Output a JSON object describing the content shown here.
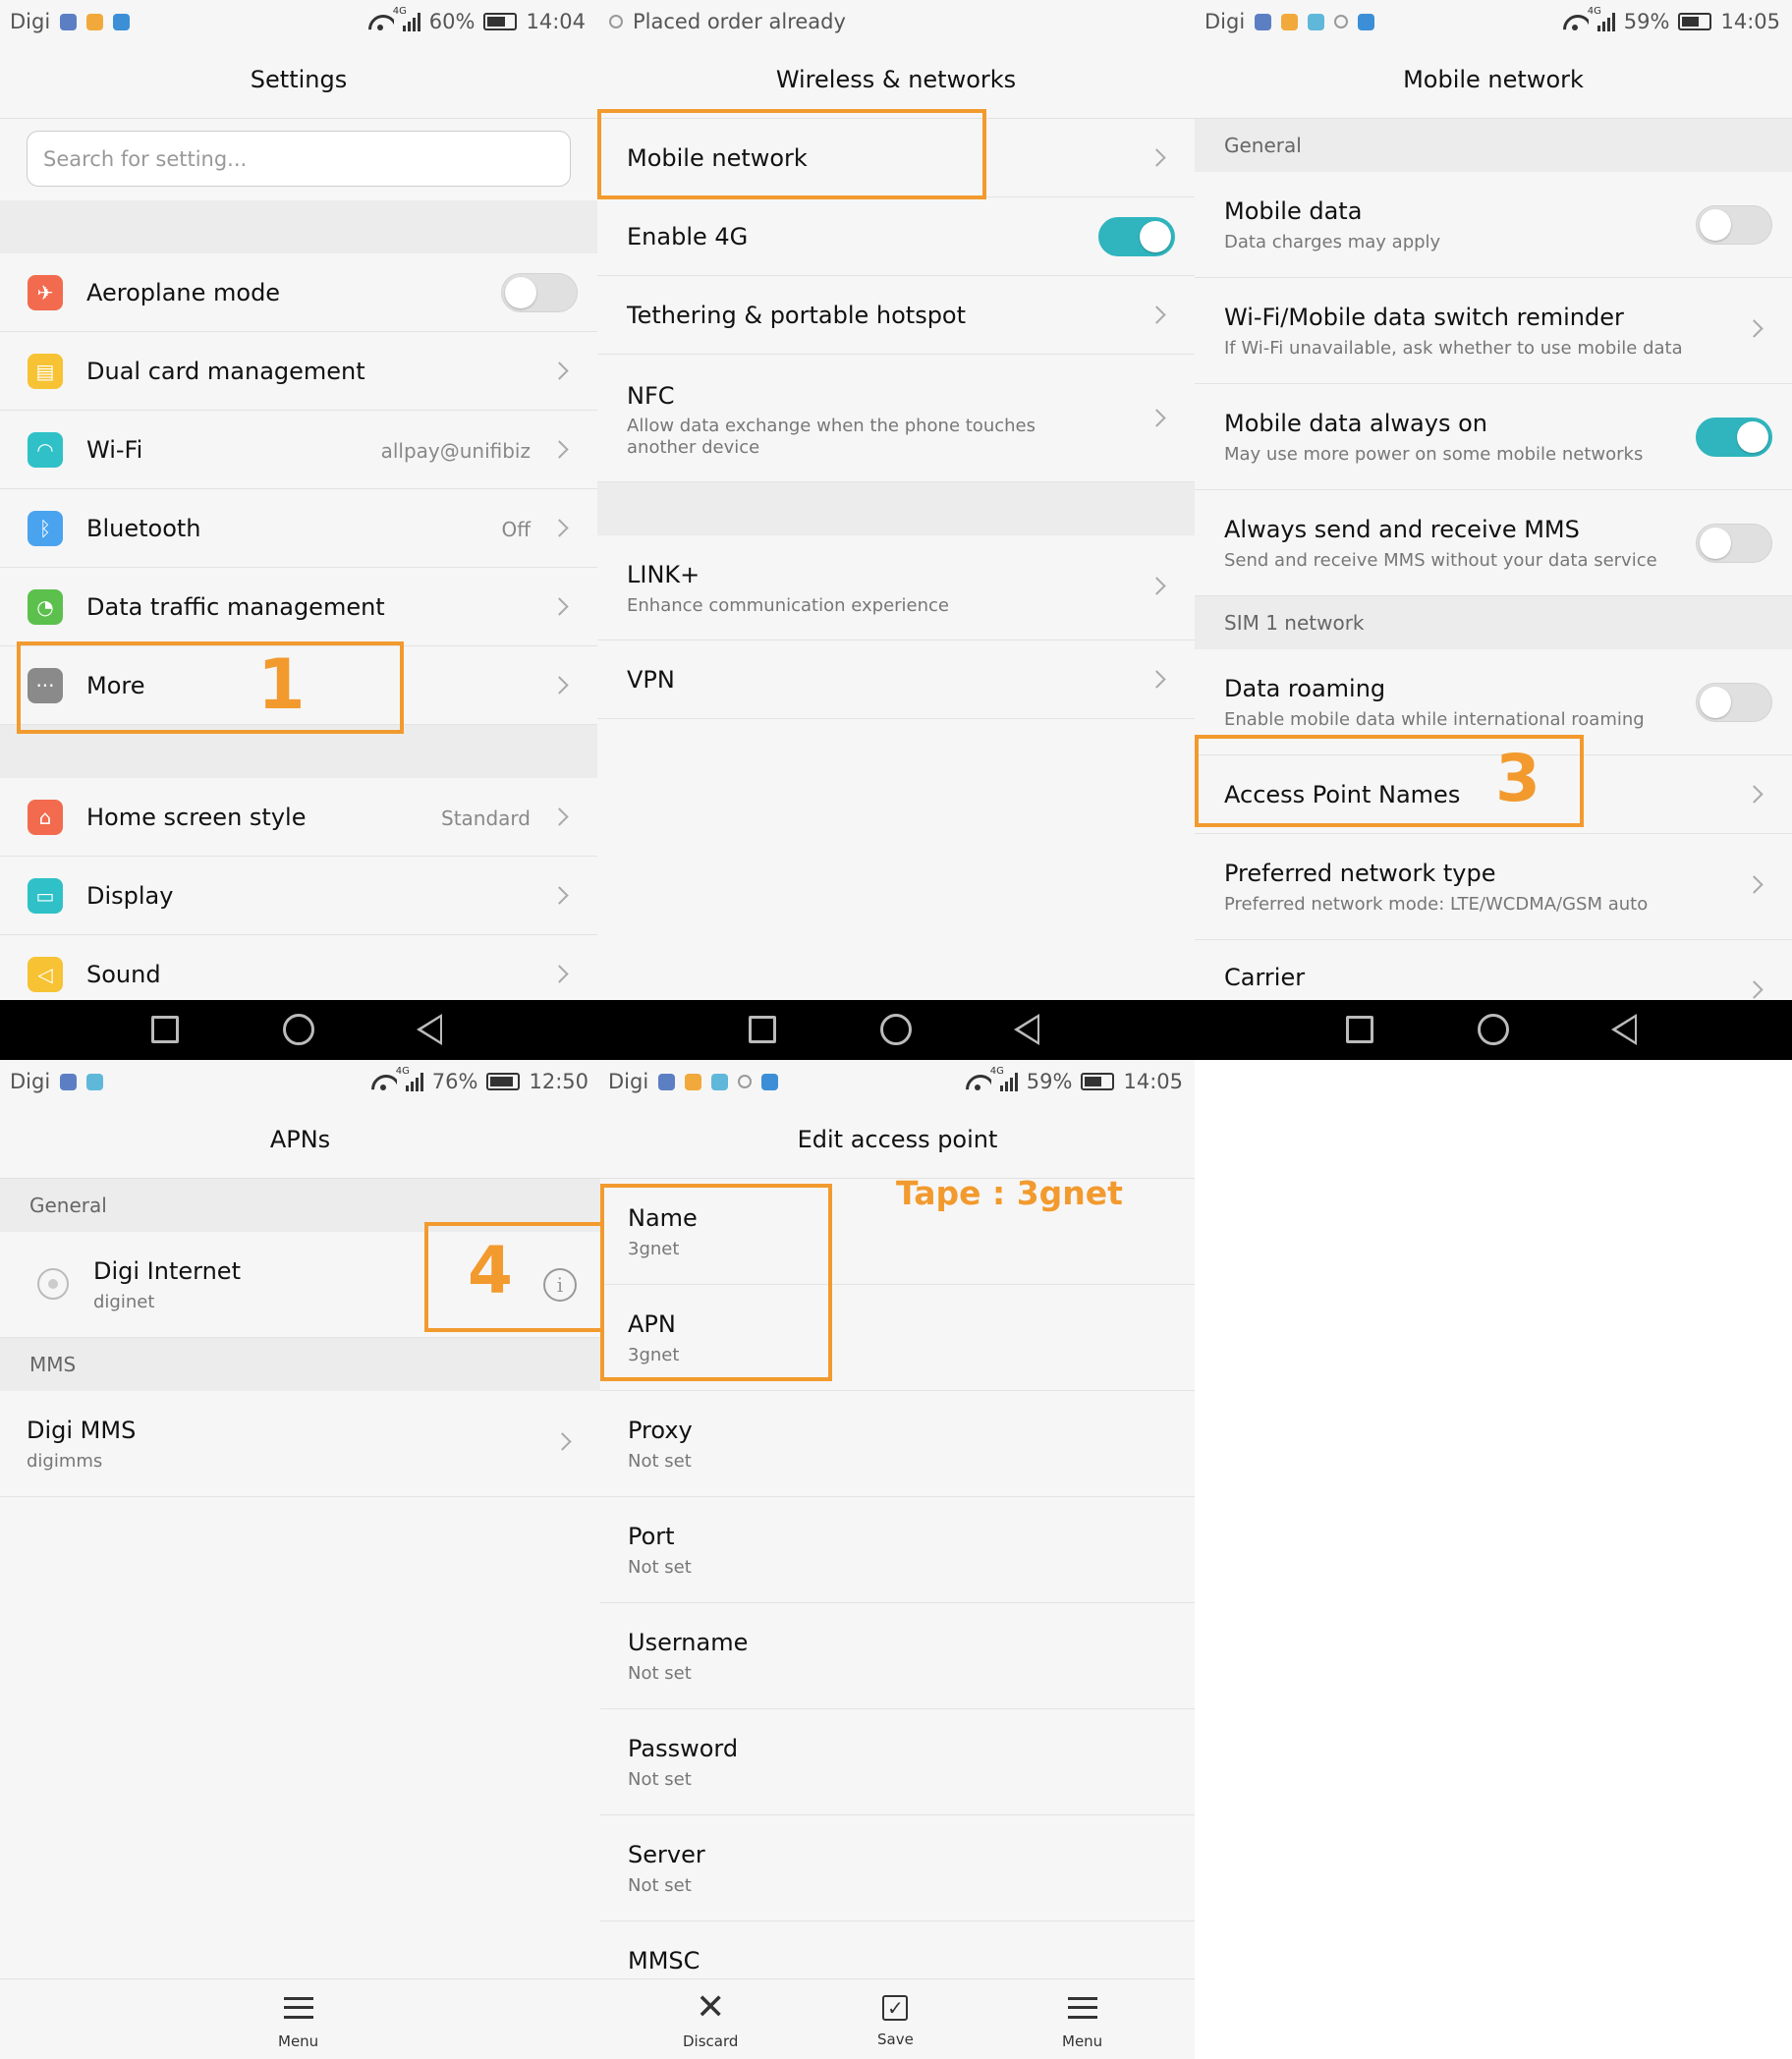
{
  "panel1": {
    "status": {
      "carrier": "Digi",
      "battery": "60%",
      "time": "14:04",
      "network": "4G"
    },
    "title": "Settings",
    "search_placeholder": "Search for setting...",
    "items": [
      {
        "label": "Aeroplane mode",
        "icon": "aeroplane-icon",
        "toggle": "off"
      },
      {
        "label": "Dual card management",
        "icon": "sim-card-icon"
      },
      {
        "label": "Wi-Fi",
        "icon": "wifi-icon",
        "value": "allpay@unifibiz"
      },
      {
        "label": "Bluetooth",
        "icon": "bluetooth-icon",
        "value": "Off"
      },
      {
        "label": "Data traffic management",
        "icon": "data-traffic-icon"
      },
      {
        "label": "More",
        "icon": "more-icon"
      },
      {
        "label": "Home screen style",
        "icon": "home-icon",
        "value": "Standard"
      },
      {
        "label": "Display",
        "icon": "display-icon"
      },
      {
        "label": "Sound",
        "icon": "sound-icon"
      }
    ],
    "step_label": "1"
  },
  "panel2": {
    "status": {
      "notification": "Placed order already"
    },
    "title": "Wireless & networks",
    "items": [
      {
        "label": "Mobile network"
      },
      {
        "label": "Enable 4G",
        "toggle": "on"
      },
      {
        "label": "Tethering & portable hotspot"
      },
      {
        "label": "NFC",
        "sub": "Allow data exchange when the phone touches another device"
      },
      {
        "label": "LINK+",
        "sub": "Enhance communication experience"
      },
      {
        "label": "VPN"
      }
    ]
  },
  "panel3": {
    "status": {
      "carrier": "Digi",
      "battery": "59%",
      "time": "14:05",
      "network": "4G"
    },
    "title": "Mobile network",
    "section_general": "General",
    "items": [
      {
        "label": "Mobile data",
        "sub": "Data charges may apply",
        "toggle": "off"
      },
      {
        "label": "Wi-Fi/Mobile data switch reminder",
        "sub": "If Wi-Fi unavailable, ask whether to use mobile data"
      },
      {
        "label": "Mobile data always on",
        "sub": "May use more power on some mobile networks",
        "toggle": "on"
      },
      {
        "label": "Always send and receive MMS",
        "sub": "Send and receive MMS without your data service",
        "toggle": "off"
      }
    ],
    "section_sim": "SIM 1 network",
    "sim_items": [
      {
        "label": "Data roaming",
        "sub": "Enable mobile data while international roaming",
        "toggle": "off"
      },
      {
        "label": "Access Point Names"
      },
      {
        "label": "Preferred network type",
        "sub": "Preferred network mode: LTE/WCDMA/GSM auto"
      },
      {
        "label": "Carrier"
      }
    ],
    "step_label": "3"
  },
  "panel4": {
    "status": {
      "carrier": "Digi",
      "battery": "76%",
      "time": "12:50",
      "network": "4G"
    },
    "title": "APNs",
    "section_general": "General",
    "apn": {
      "name": "Digi Internet",
      "sub": "diginet"
    },
    "section_mms": "MMS",
    "mms": {
      "name": "Digi MMS",
      "sub": "digimms"
    },
    "step_label": "4",
    "menu_label": "Menu"
  },
  "panel5": {
    "status": {
      "carrier": "Digi",
      "battery": "59%",
      "time": "14:05",
      "network": "4G"
    },
    "title": "Edit access point",
    "annotation": "Tape : 3gnet",
    "fields": [
      {
        "label": "Name",
        "value": "3gnet"
      },
      {
        "label": "APN",
        "value": "3gnet"
      },
      {
        "label": "Proxy",
        "value": "Not set"
      },
      {
        "label": "Port",
        "value": "Not set"
      },
      {
        "label": "Username",
        "value": "Not set"
      },
      {
        "label": "Password",
        "value": "Not set"
      },
      {
        "label": "Server",
        "value": "Not set"
      },
      {
        "label": "MMSC",
        "value": ""
      }
    ],
    "buttons": {
      "discard": "Discard",
      "save": "Save",
      "menu": "Menu"
    }
  },
  "colors": {
    "accent_toggle": "#30b5be",
    "highlight": "#f29a2e"
  }
}
